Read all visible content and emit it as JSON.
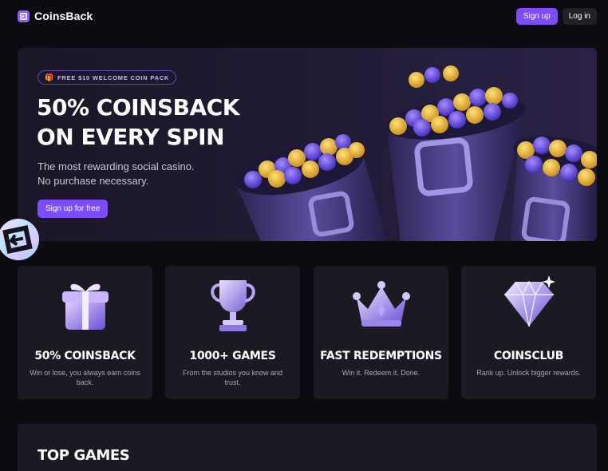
{
  "header": {
    "brand_name": "CoinsBack",
    "logo_icon": "coinsback-logo-icon",
    "signup_label": "Sign up",
    "login_label": "Log in"
  },
  "hero": {
    "promo_label": "FREE $10 WELCOME COIN PACK",
    "promo_icon": "gift-icon",
    "title_line1": "50% COINSBACK",
    "title_line2": "ON EVERY SPIN",
    "subtitle_line1": "The most rewarding social casino.",
    "subtitle_line2": "No purchase necessary.",
    "cta_label": "Sign up for free",
    "art": "coin-buckets-illustration"
  },
  "features": [
    {
      "icon": "gift-box-icon",
      "title": "50% COINSBACK",
      "desc": "Win or lose, you always earn coins back."
    },
    {
      "icon": "trophy-icon",
      "title": "1000+ GAMES",
      "desc": "From the studios you know and trust."
    },
    {
      "icon": "crown-icon",
      "title": "FAST REDEMPTIONS",
      "desc": "Win it. Redeem it. Done."
    },
    {
      "icon": "diamond-icon",
      "title": "COINSCLUB",
      "desc": "Rank up. Unlock bigger rewards."
    }
  ],
  "top_games": {
    "title": "TOP GAMES"
  },
  "colors": {
    "accent": "#7c4dff",
    "background": "#0c0b12",
    "card": "#1b1a22",
    "coin_gold": "#f2c230",
    "coin_purple": "#6a4dff"
  }
}
